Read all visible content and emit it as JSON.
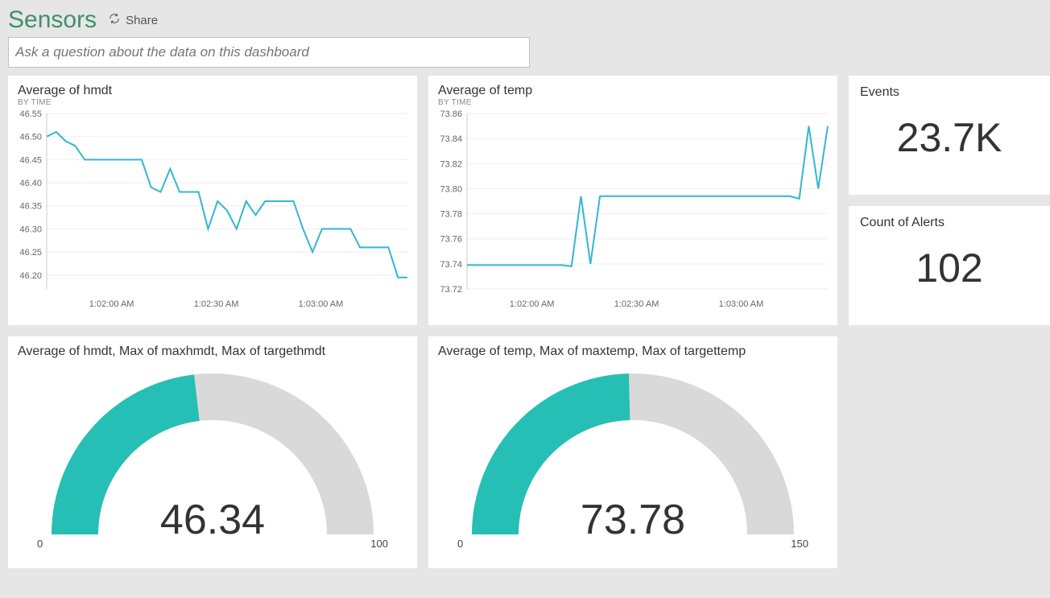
{
  "header": {
    "title": "Sensors",
    "share_label": "Share"
  },
  "ask": {
    "placeholder": "Ask a question about the data on this dashboard"
  },
  "tiles": {
    "hmdt_line": {
      "title": "Average of hmdt",
      "subtitle": "BY TIME"
    },
    "temp_line": {
      "title": "Average of temp",
      "subtitle": "BY TIME"
    },
    "events": {
      "label": "Events",
      "value": "23.7K"
    },
    "alerts": {
      "label": "Count of Alerts",
      "value": "102"
    },
    "hmdt_gauge": {
      "title": "Average of hmdt, Max of maxhmdt, Max of targethmdt",
      "value": "46.34",
      "min": "0",
      "max": "100"
    },
    "temp_gauge": {
      "title": "Average of temp, Max of maxtemp, Max of targettemp",
      "value": "73.78",
      "min": "0",
      "max": "150"
    }
  },
  "chart_data": [
    {
      "type": "line",
      "id": "hmdt_line",
      "title": "Average of hmdt",
      "subtitle": "BY TIME",
      "ylabel": "",
      "xlabel": "",
      "ylim": [
        46.17,
        46.55
      ],
      "yticks": [
        46.2,
        46.25,
        46.3,
        46.35,
        46.4,
        46.45,
        46.5,
        46.55
      ],
      "xticks": [
        "1:02:00 AM",
        "1:02:30 AM",
        "1:03:00 AM"
      ],
      "x": [
        0,
        1,
        2,
        3,
        4,
        5,
        6,
        7,
        8,
        9,
        10,
        11,
        12,
        13,
        14,
        15,
        16,
        17,
        18,
        19,
        20,
        21,
        22,
        23,
        24,
        25,
        26,
        27,
        28,
        29,
        30,
        31,
        32,
        33,
        34,
        35,
        36,
        37,
        38
      ],
      "values": [
        46.5,
        46.51,
        46.49,
        46.48,
        46.45,
        46.45,
        46.45,
        46.45,
        46.45,
        46.45,
        46.45,
        46.39,
        46.38,
        46.43,
        46.38,
        46.38,
        46.38,
        46.3,
        46.36,
        46.34,
        46.3,
        46.36,
        46.33,
        46.36,
        46.36,
        46.36,
        46.36,
        46.3,
        46.25,
        46.3,
        46.3,
        46.3,
        46.3,
        46.26,
        46.26,
        46.26,
        46.26,
        46.195,
        46.195
      ]
    },
    {
      "type": "line",
      "id": "temp_line",
      "title": "Average of temp",
      "subtitle": "BY TIME",
      "ylabel": "",
      "xlabel": "",
      "ylim": [
        73.72,
        73.86
      ],
      "yticks": [
        73.72,
        73.74,
        73.76,
        73.78,
        73.8,
        73.82,
        73.84,
        73.86
      ],
      "xticks": [
        "1:02:00 AM",
        "1:02:30 AM",
        "1:03:00 AM"
      ],
      "x": [
        0,
        1,
        2,
        3,
        4,
        5,
        6,
        7,
        8,
        9,
        10,
        11,
        12,
        13,
        14,
        15,
        16,
        17,
        18,
        19,
        20,
        21,
        22,
        23,
        24,
        25,
        26,
        27,
        28,
        29,
        30,
        31,
        32,
        33,
        34,
        35,
        36,
        37,
        38
      ],
      "values": [
        73.739,
        73.739,
        73.739,
        73.739,
        73.739,
        73.739,
        73.739,
        73.739,
        73.739,
        73.739,
        73.739,
        73.738,
        73.794,
        73.74,
        73.794,
        73.794,
        73.794,
        73.794,
        73.794,
        73.794,
        73.794,
        73.794,
        73.794,
        73.794,
        73.794,
        73.794,
        73.794,
        73.794,
        73.794,
        73.794,
        73.794,
        73.794,
        73.794,
        73.794,
        73.794,
        73.792,
        73.85,
        73.8,
        73.85
      ]
    },
    {
      "type": "gauge",
      "id": "hmdt_gauge",
      "title": "Average of hmdt, Max of maxhmdt, Max of targethmdt",
      "range": [
        0,
        100
      ],
      "value": 46.34
    },
    {
      "type": "gauge",
      "id": "temp_gauge",
      "title": "Average of temp, Max of maxtemp, Max of targettemp",
      "range": [
        0,
        150
      ],
      "value": 73.78
    },
    {
      "type": "card",
      "id": "events",
      "label": "Events",
      "value": 23700,
      "display": "23.7K"
    },
    {
      "type": "card",
      "id": "alerts",
      "label": "Count of Alerts",
      "value": 102,
      "display": "102"
    }
  ]
}
